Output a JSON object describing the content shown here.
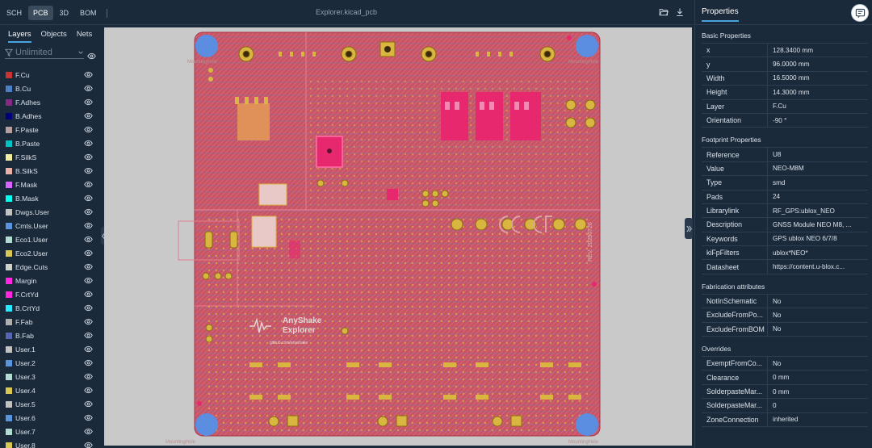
{
  "toolbar": {
    "tabs": [
      {
        "label": "SCH"
      },
      {
        "label": "PCB"
      },
      {
        "label": "3D"
      },
      {
        "label": "BOM"
      }
    ],
    "active_tab": "PCB",
    "file_title": "Explorer.kicad_pcb",
    "icons": [
      "folder-open-icon",
      "download-icon"
    ]
  },
  "left_panel": {
    "tabs": [
      {
        "label": "Layers"
      },
      {
        "label": "Objects"
      },
      {
        "label": "Nets"
      }
    ],
    "active_tab": "Layers",
    "filter": {
      "placeholder": "Unlimited"
    },
    "layers": [
      {
        "name": "F.Cu",
        "color": "#c83434"
      },
      {
        "name": "B.Cu",
        "color": "#4d7fc4"
      },
      {
        "name": "F.Adhes",
        "color": "#842c84"
      },
      {
        "name": "B.Adhes",
        "color": "#03007c"
      },
      {
        "name": "F.Paste",
        "color": "#b4a0a0"
      },
      {
        "name": "B.Paste",
        "color": "#00c2c2"
      },
      {
        "name": "F.SilkS",
        "color": "#f2eda1"
      },
      {
        "name": "B.SilkS",
        "color": "#e8b2a7"
      },
      {
        "name": "F.Mask",
        "color": "#d864ff"
      },
      {
        "name": "B.Mask",
        "color": "#02ffee"
      },
      {
        "name": "Dwgs.User",
        "color": "#c2c2c2"
      },
      {
        "name": "Cmts.User",
        "color": "#5994dc"
      },
      {
        "name": "Eco1.User",
        "color": "#b4dbd2"
      },
      {
        "name": "Eco2.User",
        "color": "#d8c852"
      },
      {
        "name": "Edge.Cuts",
        "color": "#d0d2cd"
      },
      {
        "name": "Margin",
        "color": "#ff26e2"
      },
      {
        "name": "F.CrtYd",
        "color": "#ff26e2"
      },
      {
        "name": "B.CrtYd",
        "color": "#26e9ff"
      },
      {
        "name": "F.Fab",
        "color": "#afafaf"
      },
      {
        "name": "B.Fab",
        "color": "#5865af"
      },
      {
        "name": "User.1",
        "color": "#c2c2c2"
      },
      {
        "name": "User.2",
        "color": "#5994dc"
      },
      {
        "name": "User.3",
        "color": "#b4dbd2"
      },
      {
        "name": "User.4",
        "color": "#d8c852"
      },
      {
        "name": "User.5",
        "color": "#c2c2c2"
      },
      {
        "name": "User.6",
        "color": "#5994dc"
      },
      {
        "name": "User.7",
        "color": "#b4dbd2"
      },
      {
        "name": "User.8",
        "color": "#d8c852"
      }
    ]
  },
  "board": {
    "texts": [
      "AnyShake",
      "Explorer",
      "github.com/anyshake",
      "REV. 20250726"
    ],
    "silk_labels": [
      "MountingHole",
      "MountingHole",
      "MountingHole",
      "MountingHole"
    ],
    "colors": {
      "copper": "#c95463",
      "pad": "#d8b640",
      "highlight": "#e8286e",
      "hole": "#5b8de0"
    }
  },
  "properties": {
    "title": "Properties",
    "basic": {
      "title": "Basic Properties",
      "rows": [
        {
          "key": "x",
          "value": "128.3400 mm"
        },
        {
          "key": "y",
          "value": "96.0000 mm"
        },
        {
          "key": "Width",
          "value": "16.5000 mm"
        },
        {
          "key": "Height",
          "value": "14.3000 mm"
        },
        {
          "key": "Layer",
          "value": "F.Cu"
        },
        {
          "key": "Orientation",
          "value": "-90 °"
        }
      ]
    },
    "footprint": {
      "title": "Footprint Properties",
      "rows": [
        {
          "key": "Reference",
          "value": "U8"
        },
        {
          "key": "Value",
          "value": "NEO-M8M"
        },
        {
          "key": "Type",
          "value": "smd"
        },
        {
          "key": "Pads",
          "value": "24"
        },
        {
          "key": "Librarylink",
          "value": "RF_GPS:ublox_NEO"
        },
        {
          "key": "Description",
          "value": "GNSS Module NEO M8, ..."
        },
        {
          "key": "Keywords",
          "value": "GPS ublox NEO 6/7/8"
        },
        {
          "key": "kiFpFilters",
          "value": "ublox*NEO*"
        },
        {
          "key": "Datasheet",
          "value": "https://content.u-blox.c..."
        }
      ]
    },
    "fabrication": {
      "title": "Fabrication attributes",
      "rows": [
        {
          "key": "NotInSchematic",
          "value": "No"
        },
        {
          "key": "ExcludeFromPo...",
          "value": "No"
        },
        {
          "key": "ExcludeFromBOM",
          "value": "No"
        }
      ]
    },
    "overrides": {
      "title": "Overrides",
      "rows": [
        {
          "key": "ExemptFromCo...",
          "value": "No"
        },
        {
          "key": "Clearance",
          "value": "0 mm"
        },
        {
          "key": "SolderpasteMar...",
          "value": "0 mm"
        },
        {
          "key": "SolderpasteMar...",
          "value": "0"
        },
        {
          "key": "ZoneConnection",
          "value": "inherited"
        }
      ]
    }
  }
}
